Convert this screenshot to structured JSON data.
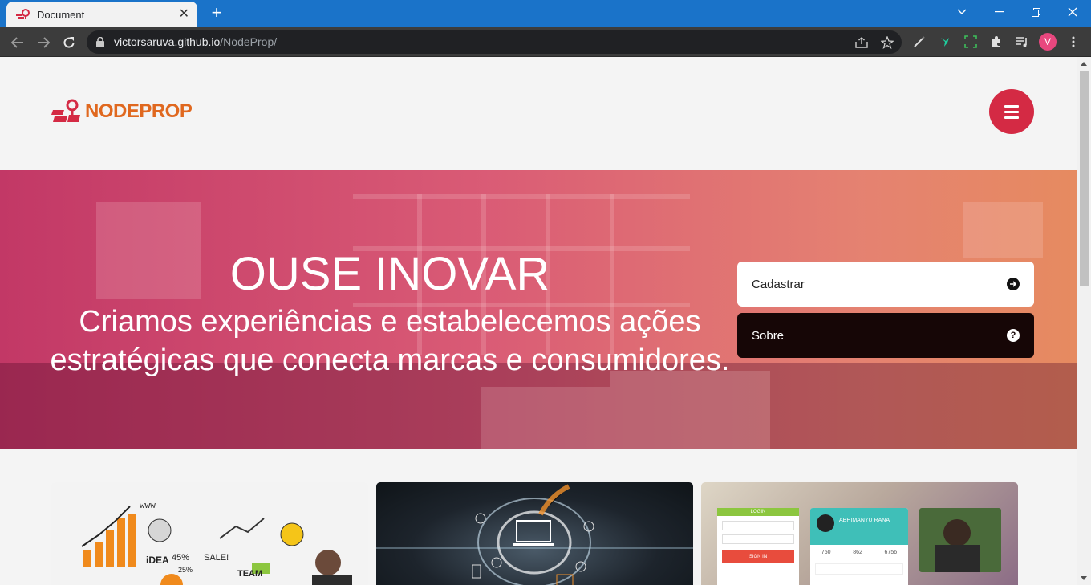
{
  "browser": {
    "tab_title": "Document",
    "tab_close": "✕",
    "new_tab": "+",
    "url_host": "victorsaruva.github.io",
    "url_path": "/NodeProp/",
    "profile_initial": "V",
    "accent": "#1a73c9"
  },
  "site": {
    "logo_text": "NODEPROP",
    "brand_color": "#e0681f",
    "menu_color": "#d42a44"
  },
  "hero": {
    "title": "OUSE INOVAR",
    "subtitle_line1": "Criamos experiências e estabelecemos ações",
    "subtitle_line2": "estratégicas que conecta marcas e consumidores.",
    "cadastrar_label": "Cadastrar",
    "sobre_label": "Sobre"
  },
  "cards": {
    "card1_caption": "www",
    "card1_words": [
      "iDEA",
      "45%",
      "SALE!",
      "TEAM",
      "25%"
    ],
    "card3_login": "LOGIN",
    "card3_name": "ABHIMANYU RANA",
    "card3_signin": "SIGN IN",
    "card3_stats": [
      "750",
      "862",
      "6756"
    ]
  }
}
